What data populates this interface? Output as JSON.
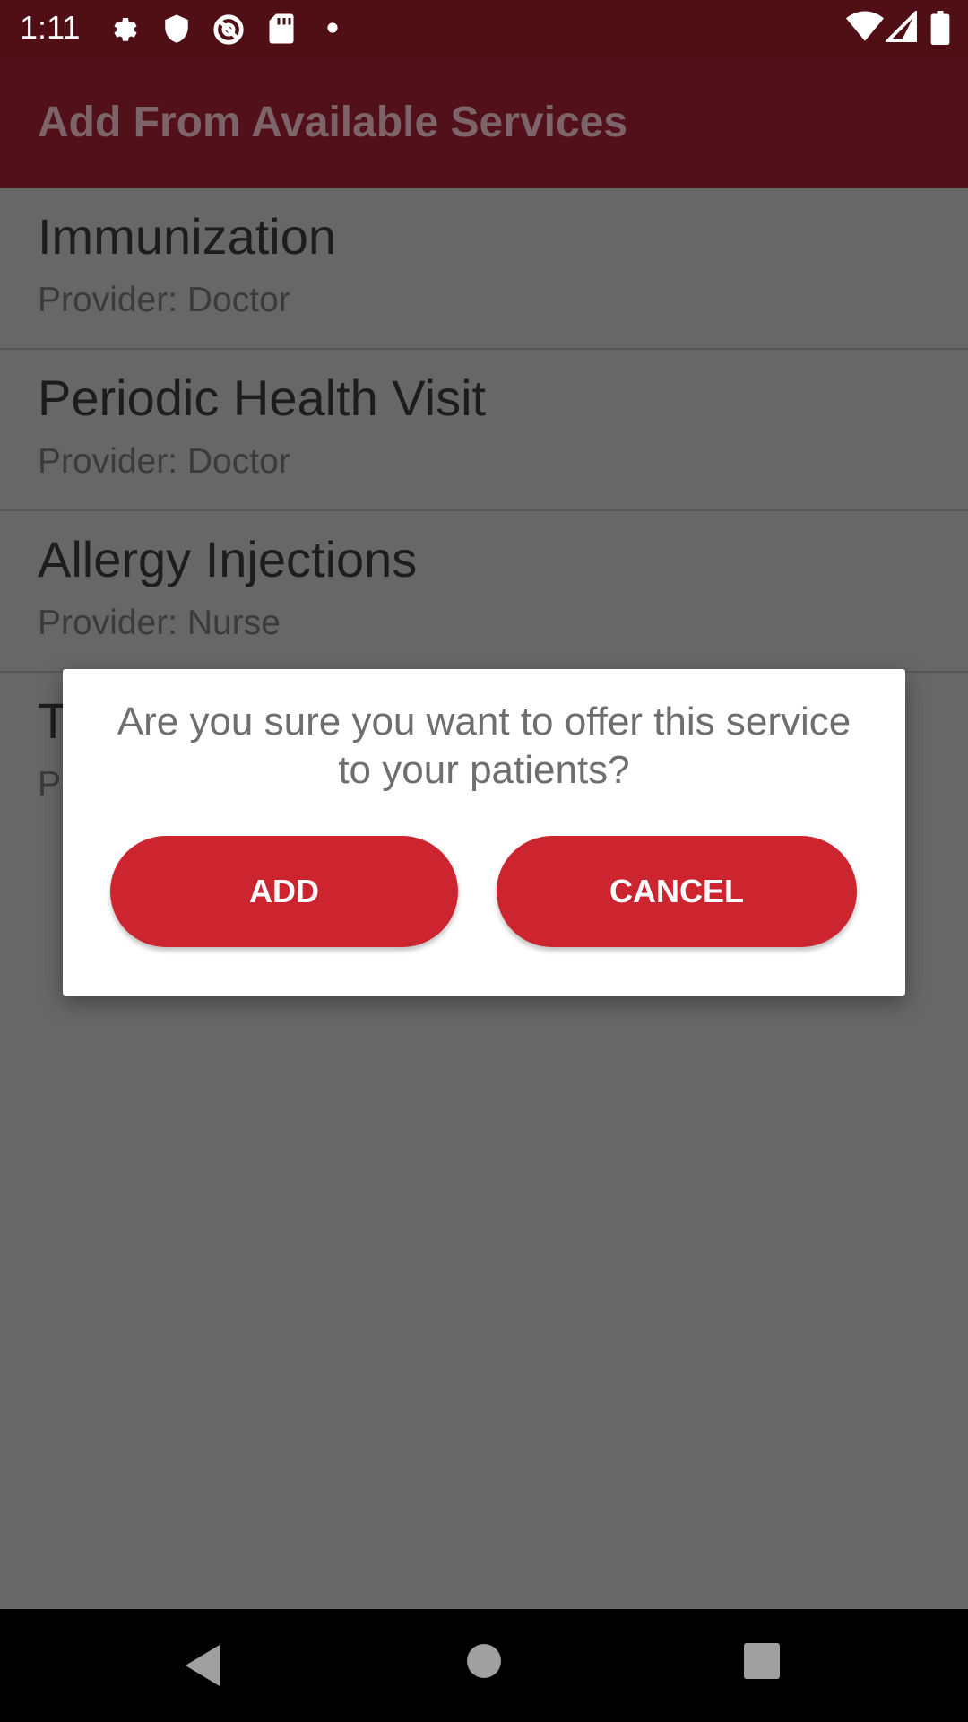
{
  "status_bar": {
    "time": "1:11",
    "left_icons": [
      "gear-icon",
      "shield-icon",
      "no-sync-icon",
      "sd-card-icon",
      "dot-icon"
    ],
    "right_icons": [
      "wifi-icon",
      "signal-icon",
      "battery-icon"
    ]
  },
  "app_bar": {
    "title": "Add From Available Services"
  },
  "services": [
    {
      "name": "Immunization",
      "provider": "Provider: Doctor"
    },
    {
      "name": "Periodic Health Visit",
      "provider": "Provider: Doctor"
    },
    {
      "name": "Allergy Injections",
      "provider": "Provider: Nurse"
    },
    {
      "name": "T",
      "provider": "P"
    }
  ],
  "dialog": {
    "message": "Are you sure you want to offer this service to your patients?",
    "add_label": "ADD",
    "cancel_label": "CANCEL"
  },
  "nav_bar": {
    "buttons": [
      "back-icon",
      "home-icon",
      "recents-icon"
    ]
  },
  "colors": {
    "status_bar": "#4f0f14",
    "app_bar": "#52101a",
    "accent_button": "#cc2530",
    "scrim_background": "#676767"
  }
}
